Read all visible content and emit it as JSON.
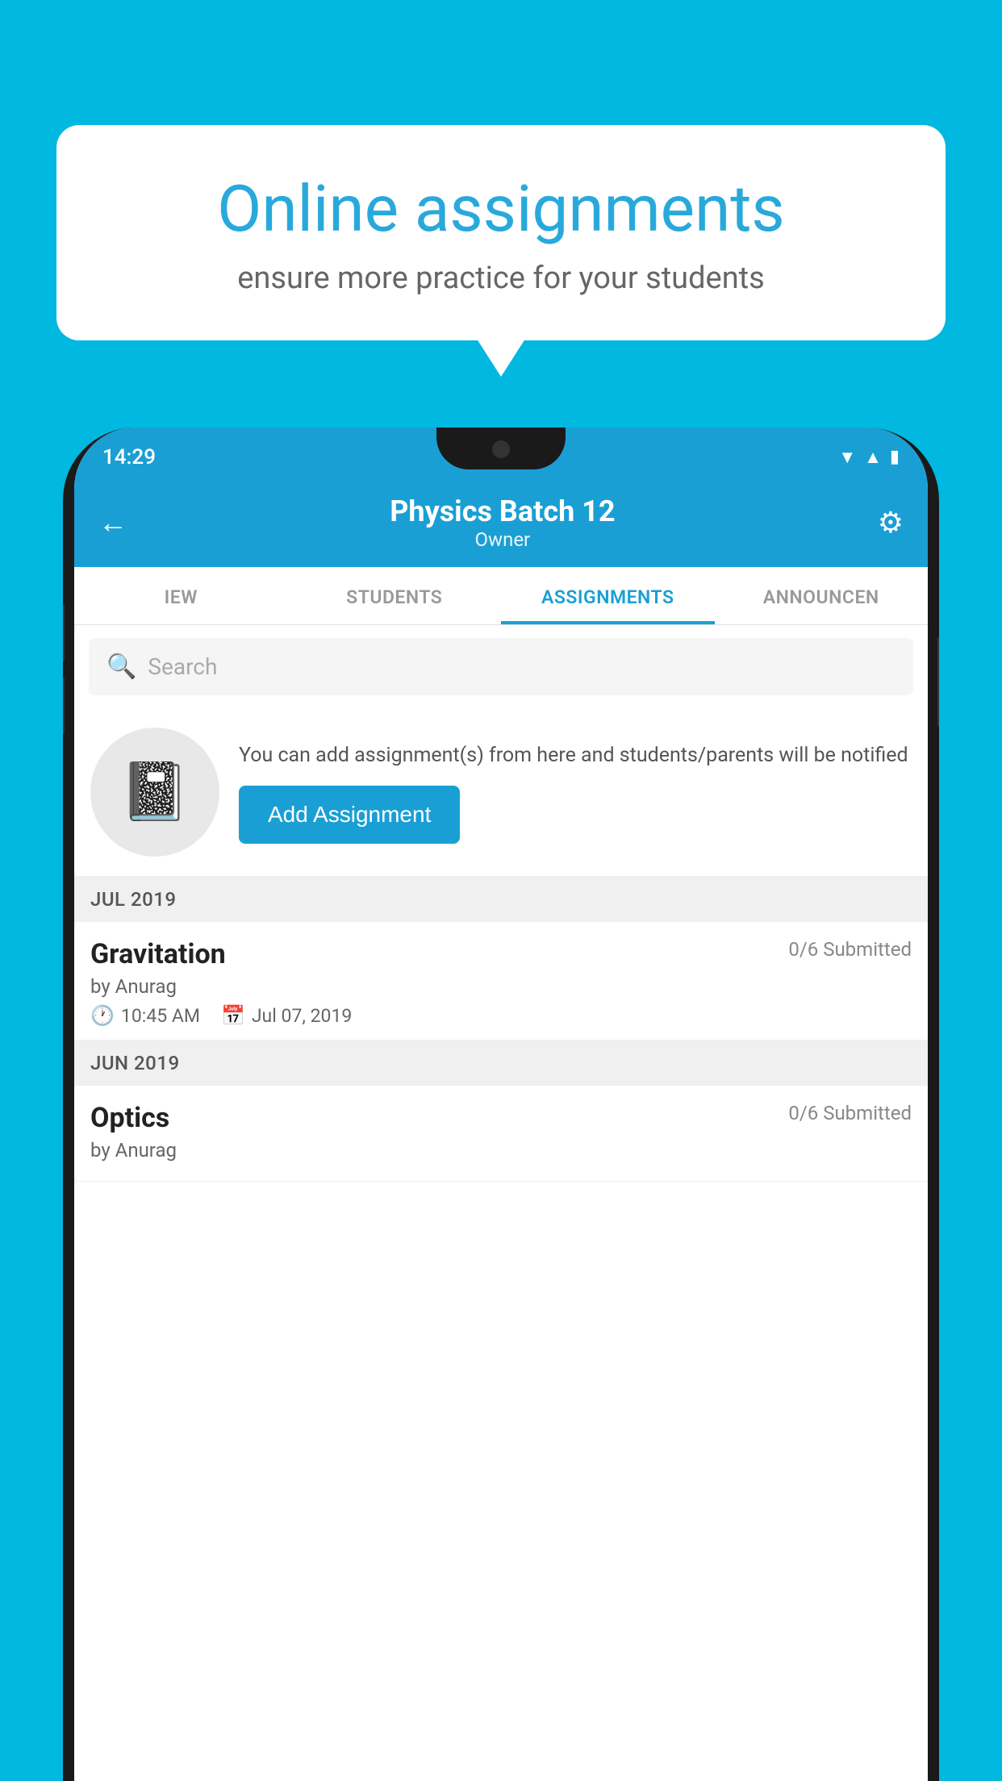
{
  "background_color": "#00b8e0",
  "speech_bubble": {
    "title": "Online assignments",
    "subtitle": "ensure more practice for your students"
  },
  "status_bar": {
    "time": "14:29",
    "icons": [
      "wifi",
      "signal",
      "battery"
    ]
  },
  "header": {
    "title": "Physics Batch 12",
    "subtitle": "Owner",
    "back_label": "←",
    "settings_label": "⚙"
  },
  "tabs": [
    {
      "label": "IEW",
      "active": false
    },
    {
      "label": "STUDENTS",
      "active": false
    },
    {
      "label": "ASSIGNMENTS",
      "active": true
    },
    {
      "label": "ANNOUNCEN",
      "active": false
    }
  ],
  "search": {
    "placeholder": "Search"
  },
  "promo": {
    "text": "You can add assignment(s) from here and students/parents will be notified",
    "button_label": "Add Assignment"
  },
  "sections": [
    {
      "label": "JUL 2019",
      "assignments": [
        {
          "name": "Gravitation",
          "status": "0/6 Submitted",
          "by": "by Anurag",
          "time": "10:45 AM",
          "date": "Jul 07, 2019"
        }
      ]
    },
    {
      "label": "JUN 2019",
      "assignments": [
        {
          "name": "Optics",
          "status": "0/6 Submitted",
          "by": "by Anurag",
          "time": "",
          "date": ""
        }
      ]
    }
  ]
}
